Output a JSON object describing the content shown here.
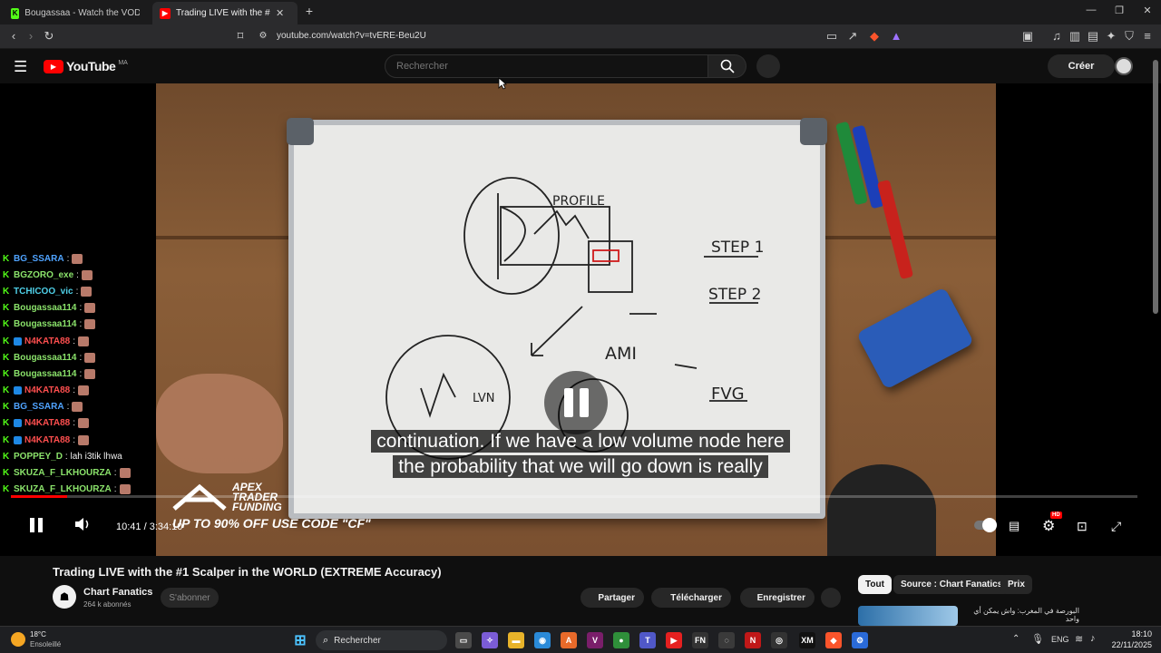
{
  "browser": {
    "tabs": [
      {
        "label": "Bougassaa - Watch the VOD on Kick",
        "icon": "kick-icon"
      },
      {
        "label": "Trading LIVE with the #1 Scalp",
        "icon": "youtube-icon"
      }
    ],
    "new_tab": "+",
    "url": "youtube.com/watch?v=tvERE-Beu2U"
  },
  "youtube": {
    "logo_text": "YouTube",
    "region": "MA",
    "search_placeholder": "Rechercher",
    "create_label": "Créer"
  },
  "chat": {
    "messages": [
      {
        "user": "BG_SSARA",
        "text": ":",
        "color": "#4fa3ff",
        "badge": false
      },
      {
        "user": "BGZORO_exe",
        "text": ":",
        "color": "#8be36b",
        "badge": false
      },
      {
        "user": "TCHICOO_vic",
        "text": ":",
        "color": "#4fd0e8",
        "badge": false
      },
      {
        "user": "Bougassaa114",
        "text": ":",
        "color": "#8be36b",
        "badge": false
      },
      {
        "user": "Bougassaa114",
        "text": ":",
        "color": "#8be36b",
        "badge": false
      },
      {
        "user": "N4KATA88",
        "text": ":",
        "color": "#ff4f4f",
        "badge": true
      },
      {
        "user": "Bougassaa114",
        "text": ":",
        "color": "#8be36b",
        "badge": false
      },
      {
        "user": "Bougassaa114",
        "text": ":",
        "color": "#8be36b",
        "badge": false
      },
      {
        "user": "N4KATA88",
        "text": ":",
        "color": "#ff4f4f",
        "badge": true
      },
      {
        "user": "BG_SSARA",
        "text": ":",
        "color": "#4fa3ff",
        "badge": false
      },
      {
        "user": "N4KATA88",
        "text": ":",
        "color": "#ff4f4f",
        "badge": true
      },
      {
        "user": "N4KATA88",
        "text": ":",
        "color": "#ff4f4f",
        "badge": true
      },
      {
        "user": "POPPEY_D",
        "text": ": lah i3tik lhwa",
        "color": "#8be36b",
        "badge": false
      },
      {
        "user": "SKUZA_F_LKHOURZA",
        "text": ":",
        "color": "#8be36b",
        "badge": false
      },
      {
        "user": "SKUZA_F_LKHOURZA",
        "text": ":",
        "color": "#8be36b",
        "badge": false
      }
    ]
  },
  "player": {
    "subtitle_line1": "continuation. If we have a low volume node here",
    "subtitle_line2": "the probability that we will go down is really",
    "current_time": "10:41",
    "duration": "3:34:10",
    "progress_fraction": 0.05,
    "hd_badge": "HD",
    "ad_brand": "APEX TRADER FUNDING",
    "ad_line1": "APEX",
    "ad_line2": "TRADER",
    "ad_line3": "FUNDING",
    "ad_offer": "UP TO 90% OFF USE CODE \"CF\"",
    "board_text": {
      "profile": "PROFILE",
      "step1": "STEP 1",
      "step2": "STEP 2",
      "ami": "AMI",
      "fvg": "FVG",
      "lvn": "LVN"
    }
  },
  "video": {
    "title": "Trading LIVE with the #1 Scalper in the WORLD (EXTREME Accuracy)",
    "channel": "Chart Fanatics",
    "subscribers": "264 k abonnés",
    "subscribe_label": "S'abonner",
    "share_label": "Partager",
    "download_label": "Télécharger",
    "save_label": "Enregistrer"
  },
  "chips": [
    "Tout",
    "Source : Chart Fanatics",
    "Prix"
  ],
  "recommendation": {
    "text": "البورصة في المغرب: واش يمكن أي واحد"
  },
  "taskbar": {
    "weather_temp": "18°C",
    "weather_desc": "Ensoleillé",
    "search_label": "Rechercher",
    "lang": "ENG",
    "time": "18:10",
    "date": "22/11/2025"
  }
}
